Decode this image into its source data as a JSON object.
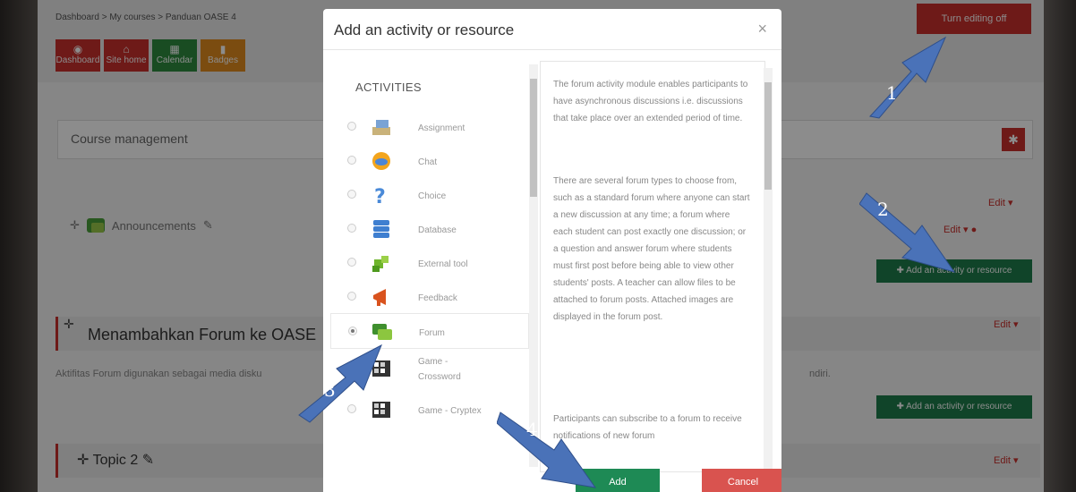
{
  "breadcrumb": "Dashboard > My courses > Panduan OASE 4",
  "nav": [
    {
      "label": "Dashboard",
      "icon": "dashboard-icon"
    },
    {
      "label": "Site home",
      "icon": "home-icon"
    },
    {
      "label": "Calendar",
      "icon": "calendar-icon"
    },
    {
      "label": "Badges",
      "icon": "bookmark-icon"
    }
  ],
  "turn_editing": "Turn editing off",
  "course_management": "Course management",
  "edit_label": "Edit",
  "announcements": "Announcements",
  "add_activity_label": "Add an activity or resource",
  "section_title": "Menambahkan Forum ke OASE",
  "section_desc": "Aktifitas Forum digunakan sebagai media disku",
  "section_desc_tail": "ndiri.",
  "topic2": "Topic 2",
  "modal": {
    "title": "Add an activity or resource",
    "close": "×",
    "section": "ACTIVITIES",
    "items": [
      {
        "name": "Assignment",
        "icon": "assignment-icon"
      },
      {
        "name": "Chat",
        "icon": "chat-icon"
      },
      {
        "name": "Choice",
        "icon": "question-icon"
      },
      {
        "name": "Database",
        "icon": "database-icon"
      },
      {
        "name": "External tool",
        "icon": "puzzle-icon"
      },
      {
        "name": "Feedback",
        "icon": "megaphone-icon"
      },
      {
        "name": "Forum",
        "icon": "forum-icon",
        "selected": true
      },
      {
        "name": "Game -",
        "name2": "Crossword",
        "icon": "crossword-icon"
      },
      {
        "name": "Game - Cryptex",
        "icon": "cryptex-icon"
      }
    ],
    "desc_p1": "The forum activity module enables participants to have asynchronous discussions i.e. discussions that take place over an extended period of time.",
    "desc_p2": "There are several forum types to choose from, such as a standard forum where anyone can start a new discussion at any time; a forum where each student can post exactly one discussion; or a question and answer forum where students must first post before being able to view other students' posts. A teacher can allow files to be attached to forum posts. Attached images are displayed in the forum post.",
    "desc_p3": "Participants can subscribe to a forum to receive notifications of new forum",
    "add": "Add",
    "cancel": "Cancel"
  },
  "annotations": [
    "1",
    "2",
    "3",
    "4"
  ],
  "colors": {
    "red": "#c9302c",
    "green": "#1e7c4b",
    "arrow": "#4a72b8"
  }
}
